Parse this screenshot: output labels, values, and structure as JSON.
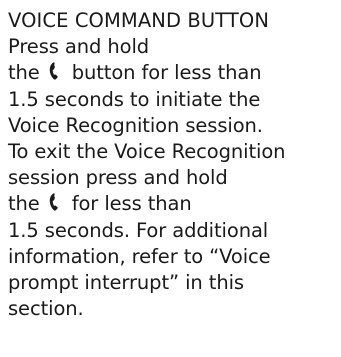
{
  "heading": "VOICE COMMAND BUTTON",
  "lines": {
    "l1": "Press and hold",
    "l2a": "the",
    "l2b": "button for less than",
    "l3": "1.5 seconds to initiate the",
    "l4": "Voice Recognition session.",
    "l5": "To exit the Voice Recognition",
    "l6": "session press and hold",
    "l7a": "the",
    "l7b": "for less than",
    "l8": "1.5 seconds. For additional",
    "l9": "information, refer to “Voice",
    "l10": "prompt interrupt” in this",
    "l11": "section."
  },
  "icons": {
    "talk": "phone-talk-icon"
  },
  "colors": {
    "text": "#1a1a1a",
    "background": "#ffffff"
  }
}
